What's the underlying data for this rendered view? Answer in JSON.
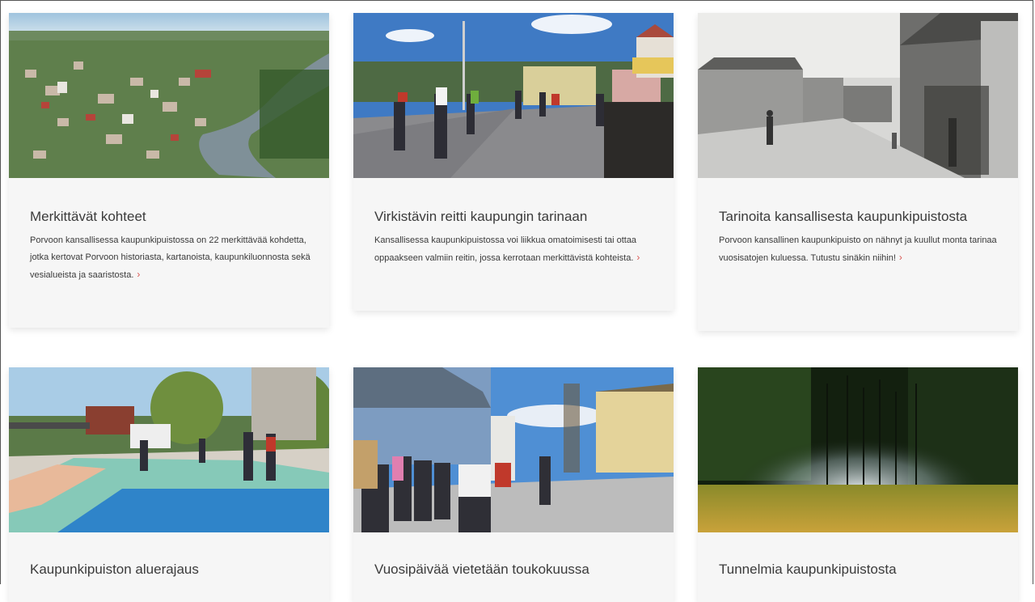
{
  "cards": [
    {
      "title": "Merkittävät kohteet",
      "text": "Porvoon kansallisessa kaupunkipuistossa on 22 merkittävää kohdetta, jotka kertovat Porvoon historiasta, kartanoista, kaupunkiluonnosta sekä vesialueista ja saaristosta.",
      "image_icon": "aerial-town-river-photo"
    },
    {
      "title": "Virkistävin reitti kaupungin tarinaan",
      "text": "Kansallisessa kaupunkipuistossa voi liikkua omatoimisesti tai ottaa oppaakseen valmiin reitin, jossa kerrotaan merkittävistä kohteista.",
      "image_icon": "bridge-walkers-photo"
    },
    {
      "title": "Tarinoita kansallisesta kaupunkipuistosta",
      "text": "Porvoon kansallinen kaupunkipuisto on nähnyt ja kuullut monta tarinaa vuosisatojen kuluessa. Tutustu sinäkin niihin!",
      "image_icon": "historic-street-photo"
    },
    {
      "title": "Kaupunkipuiston aluerajaus",
      "text": "",
      "image_icon": "map-plaza-photo"
    },
    {
      "title": "Vuosipäivää vietetään toukokuussa",
      "text": "",
      "image_icon": "guided-tour-crowd-photo"
    },
    {
      "title": "Tunnelmia kaupunkipuistosta",
      "text": "",
      "image_icon": "misty-forest-photo"
    }
  ],
  "more_icon": "chevron-right-icon",
  "colors": {
    "accent": "#d9534f",
    "card_bg": "#f6f6f6"
  }
}
